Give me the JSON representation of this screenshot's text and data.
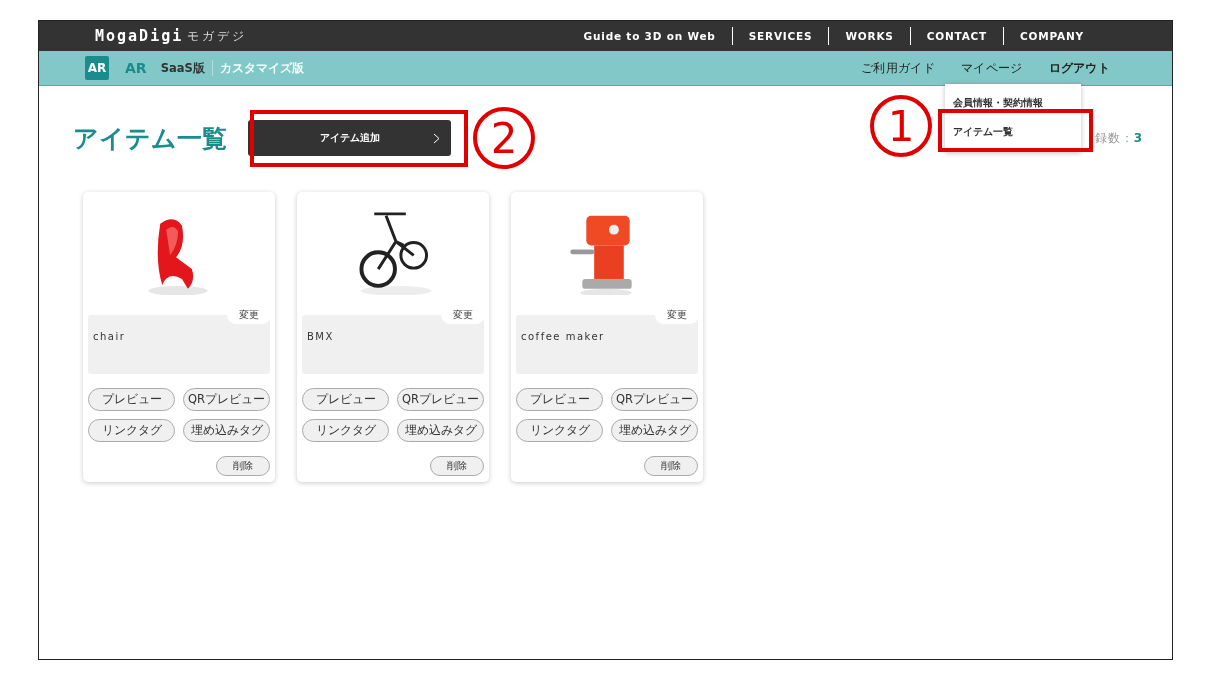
{
  "header": {
    "logo": "MogaDigi",
    "logo_kana": "モガデジ",
    "nav": [
      "Guide to 3D on Web",
      "SERVICES",
      "WORKS",
      "CONTACT",
      "COMPANY"
    ]
  },
  "subbar": {
    "badge": "AR",
    "product": "AR",
    "editions": [
      {
        "label": "SaaS版",
        "selected": true
      },
      {
        "label": "カスタマイズ版",
        "selected": false
      }
    ],
    "links": [
      "ご利用ガイド",
      "マイページ",
      "ログアウト"
    ]
  },
  "dropdown": {
    "items": [
      "会員情報・契約情報",
      "アイテム一覧"
    ]
  },
  "page": {
    "title": "アイテム一覧",
    "add_button": "アイテム追加",
    "count_label": "録数：",
    "count": "3"
  },
  "items": [
    {
      "name": "chair",
      "edit": "変更",
      "actions": [
        "プレビュー",
        "QRプレビュー",
        "リンクタグ",
        "埋め込みタグ"
      ],
      "delete": "削除"
    },
    {
      "name": "BMX",
      "edit": "変更",
      "actions": [
        "プレビュー",
        "QRプレビュー",
        "リンクタグ",
        "埋め込みタグ"
      ],
      "delete": "削除"
    },
    {
      "name": "coffee maker",
      "edit": "変更",
      "actions": [
        "プレビュー",
        "QRプレビュー",
        "リンクタグ",
        "埋め込みタグ"
      ],
      "delete": "削除"
    }
  ],
  "annotations": [
    {
      "number": "2"
    },
    {
      "number": "1"
    }
  ]
}
